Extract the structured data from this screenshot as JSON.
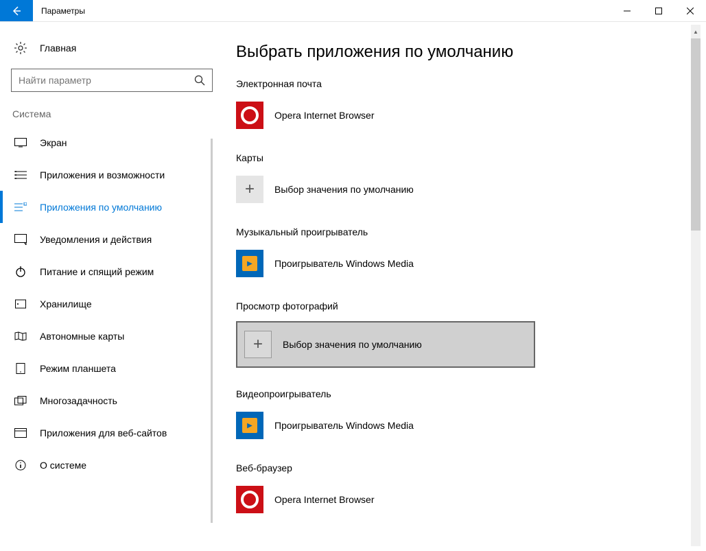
{
  "window": {
    "title": "Параметры"
  },
  "sidebar": {
    "home": "Главная",
    "search_placeholder": "Найти параметр",
    "group": "Система",
    "items": [
      {
        "label": "Экран"
      },
      {
        "label": "Приложения и возможности"
      },
      {
        "label": "Приложения по умолчанию"
      },
      {
        "label": "Уведомления и действия"
      },
      {
        "label": "Питание и спящий режим"
      },
      {
        "label": "Хранилище"
      },
      {
        "label": "Автономные карты"
      },
      {
        "label": "Режим планшета"
      },
      {
        "label": "Многозадачность"
      },
      {
        "label": "Приложения для веб-сайтов"
      },
      {
        "label": "О системе"
      }
    ]
  },
  "content": {
    "title": "Выбрать приложения по умолчанию",
    "sections": {
      "email": {
        "label": "Электронная почта",
        "app": "Opera Internet Browser"
      },
      "maps": {
        "label": "Карты",
        "app": "Выбор значения по умолчанию"
      },
      "music": {
        "label": "Музыкальный проигрыватель",
        "app": "Проигрыватель Windows Media"
      },
      "photo": {
        "label": "Просмотр фотографий",
        "app": "Выбор значения по умолчанию"
      },
      "video": {
        "label": "Видеопроигрыватель",
        "app": "Проигрыватель Windows Media"
      },
      "browser": {
        "label": "Веб-браузер",
        "app": "Opera Internet Browser"
      }
    }
  }
}
